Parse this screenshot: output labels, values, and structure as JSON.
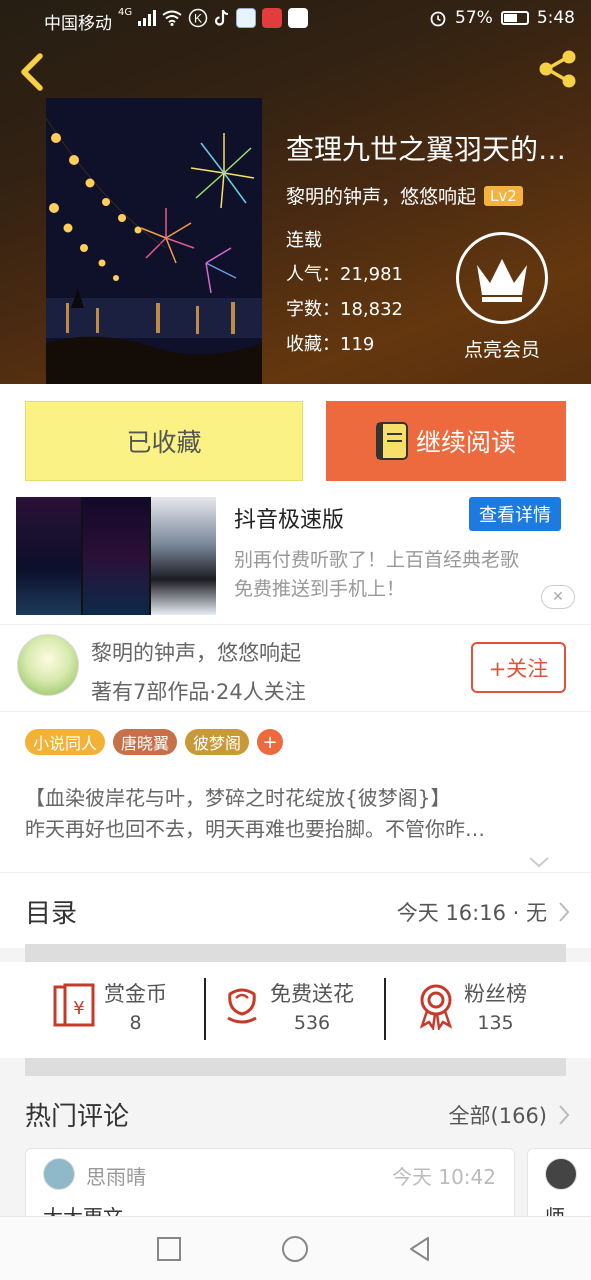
{
  "status_bar": {
    "carrier": "中国移动",
    "network": "4G",
    "battery": "57%",
    "time": "5:48"
  },
  "book": {
    "title": "查理九世之翼羽天的…",
    "author_line": "黎明的钟声，悠悠响起",
    "level": "Lv2",
    "serial_status": "连载",
    "popularity_label": "人气：",
    "popularity": "21,981",
    "word_count_label": "字数：",
    "word_count": "18,832",
    "favorites_label": "收藏：",
    "favorites": "119",
    "vip_label": "点亮会员"
  },
  "actions": {
    "favorited_label": "已收藏",
    "continue_label": "继续阅读"
  },
  "ad": {
    "title": "抖音极速版",
    "button": "查看详情",
    "desc_line1": "别再付费听歌了！上百首经典老歌",
    "desc_line2": "免费推送到手机上！",
    "close": "✕"
  },
  "author": {
    "name": "黎明的钟声，悠悠响起",
    "meta": "著有7部作品·24人关注",
    "follow": "+关注"
  },
  "tags": [
    {
      "label": "小说同人",
      "color": "#f3b236"
    },
    {
      "label": "唐晓翼",
      "color": "#c7704a"
    },
    {
      "label": "彼梦阁",
      "color": "#c99938"
    }
  ],
  "tag_plus": "+",
  "intro": {
    "line1": "【血染彼岸花与叶，梦碎之时花绽放{彼梦阁}】",
    "line2": "昨天再好也回不去，明天再难也要抬脚。不管你昨…"
  },
  "toc": {
    "label": "目录",
    "update": "今天 16:16 · 无"
  },
  "rewards": {
    "coins_label": "赏金币",
    "coins_value": "8",
    "flowers_label": "免费送花",
    "flowers_value": "536",
    "fans_label": "粉丝榜",
    "fans_value": "135"
  },
  "comments": {
    "title": "热门评论",
    "all": "全部(166)",
    "cards": [
      {
        "name": "思雨晴",
        "time": "今天 10:42",
        "body": "大大更文"
      },
      {
        "name": "",
        "time": "",
        "body": "师"
      }
    ]
  },
  "colors": {
    "accent_orange": "#ec6a3d",
    "fav_yellow": "#fbf285",
    "ad_blue": "#1d7be0",
    "icon_red": "#c9392a"
  }
}
